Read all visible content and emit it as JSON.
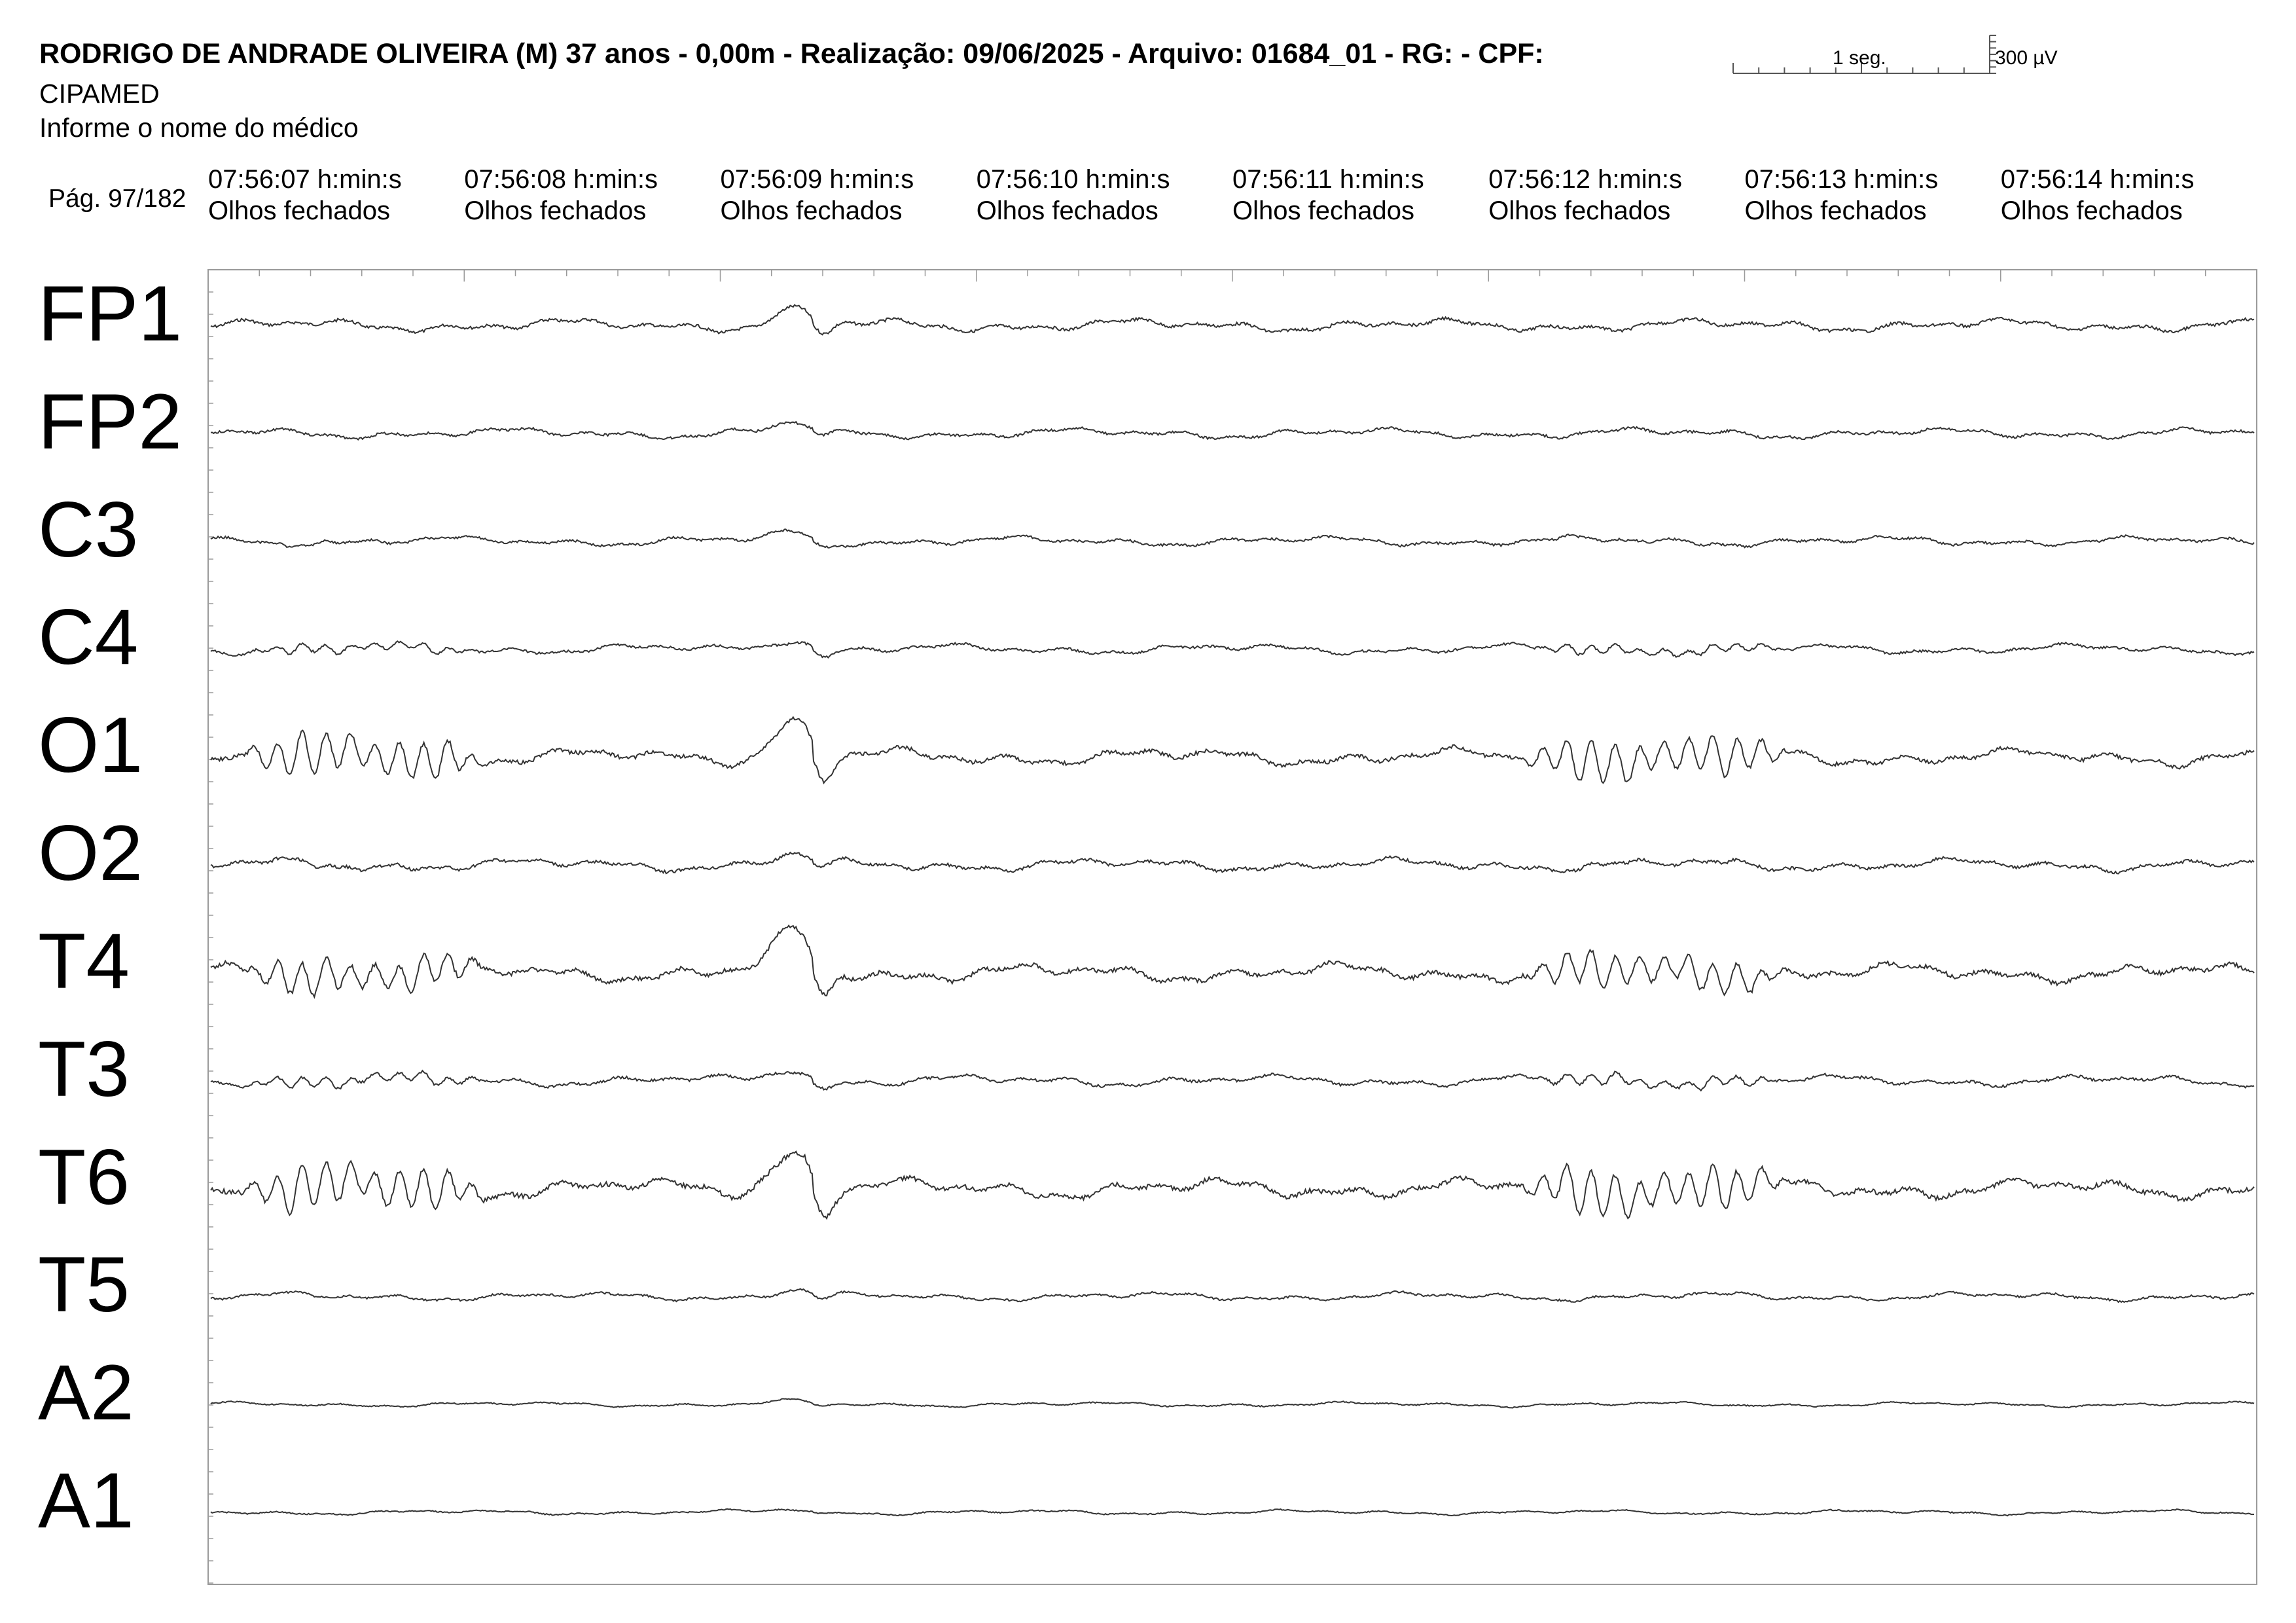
{
  "header": {
    "title": "RODRIGO DE ANDRADE OLIVEIRA (M) 37 anos - 0,00m - Realização: 09/06/2025 - Arquivo: 01684_01 - RG:  - CPF:",
    "clinic": "CIPAMED",
    "doctor": "Informe o nome do médico",
    "page": "Pág. 97/182"
  },
  "scale": {
    "time_label": "1 seg.",
    "amplitude_label": "300 µV"
  },
  "chart_data": {
    "type": "line",
    "title": "",
    "xlabel": "",
    "ylabel": "",
    "time_markers": [
      {
        "time": "07:56:07 h:min:s",
        "state": "Olhos fechados"
      },
      {
        "time": "07:56:08 h:min:s",
        "state": "Olhos fechados"
      },
      {
        "time": "07:56:09 h:min:s",
        "state": "Olhos fechados"
      },
      {
        "time": "07:56:10 h:min:s",
        "state": "Olhos fechados"
      },
      {
        "time": "07:56:11 h:min:s",
        "state": "Olhos fechados"
      },
      {
        "time": "07:56:12 h:min:s",
        "state": "Olhos fechados"
      },
      {
        "time": "07:56:13 h:min:s",
        "state": "Olhos fechados"
      },
      {
        "time": "07:56:14 h:min:s",
        "state": "Olhos fechados"
      }
    ],
    "xlim_seconds": [
      0,
      8
    ],
    "grid": false,
    "channels": [
      {
        "name": "FP1",
        "alpha_bursts": 0.0,
        "bg": 0.9,
        "artifact": 1.6
      },
      {
        "name": "FP2",
        "alpha_bursts": 0.0,
        "bg": 0.75,
        "artifact": 1.0
      },
      {
        "name": "C3",
        "alpha_bursts": 0.1,
        "bg": 0.7,
        "artifact": 0.9
      },
      {
        "name": "C4",
        "alpha_bursts": 0.55,
        "bg": 0.7,
        "artifact": 1.2
      },
      {
        "name": "O1",
        "alpha_bursts": 2.7,
        "bg": 1.2,
        "artifact": 4.0
      },
      {
        "name": "O2",
        "alpha_bursts": 0.15,
        "bg": 0.9,
        "artifact": 1.0
      },
      {
        "name": "T4",
        "alpha_bursts": 2.2,
        "bg": 1.3,
        "artifact": 4.2
      },
      {
        "name": "T3",
        "alpha_bursts": 0.7,
        "bg": 0.8,
        "artifact": 1.4
      },
      {
        "name": "T6",
        "alpha_bursts": 2.9,
        "bg": 1.4,
        "artifact": 4.2
      },
      {
        "name": "T5",
        "alpha_bursts": 0.05,
        "bg": 0.6,
        "artifact": 0.7
      },
      {
        "name": "A2",
        "alpha_bursts": 0.0,
        "bg": 0.35,
        "artifact": 0.3
      },
      {
        "name": "A1",
        "alpha_bursts": 0.0,
        "bg": 0.35,
        "artifact": 0.3
      }
    ],
    "alpha_burst_windows_seconds": [
      [
        0.1,
        1.1
      ],
      [
        5.1,
        6.2
      ]
    ],
    "artifact_time_seconds": 2.28,
    "trace_color": "#333333",
    "frame_color": "#9a9a9a"
  }
}
